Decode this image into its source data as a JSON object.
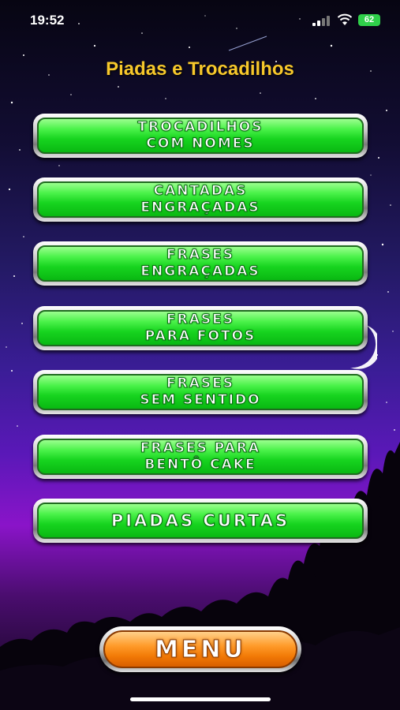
{
  "status_bar": {
    "time": "19:52",
    "battery": "62"
  },
  "title": "Piadas e Trocadilhos",
  "buttons": [
    {
      "line1": "TROCADILHOS",
      "line2": "COM NOMES"
    },
    {
      "line1": "CANTADAS",
      "line2": "ENGRAÇADAS"
    },
    {
      "line1": "FRASES",
      "line2": "ENGRAÇADAS"
    },
    {
      "line1": "FRASES",
      "line2": "PARA FOTOS"
    },
    {
      "line1": "FRASES",
      "line2": "SEM SENTIDO"
    },
    {
      "line1": "FRASES PARA",
      "line2": "BENTÔ CAKE"
    },
    {
      "line1": "PIADAS CURTAS"
    }
  ],
  "menu_button": {
    "label": "MENU"
  },
  "colors": {
    "title": "#f7c82b",
    "button_green": "#17d41f",
    "menu_orange": "#f27a06",
    "battery": "#2fd04a"
  },
  "icons": {
    "signal": "cellular-signal-icon",
    "wifi": "wifi-icon",
    "moon": "crescent-moon-icon"
  }
}
